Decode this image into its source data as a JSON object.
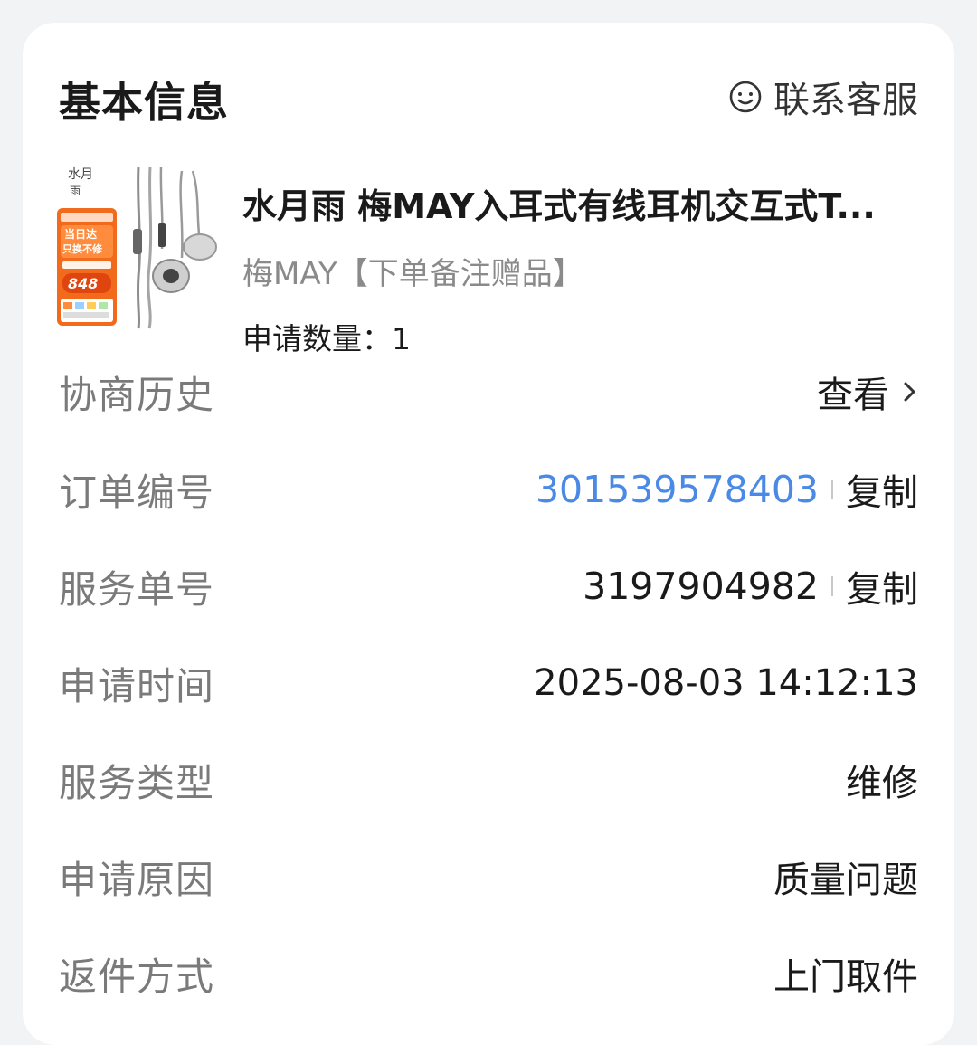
{
  "header": {
    "title": "基本信息",
    "service_label": "联系客服"
  },
  "product": {
    "title": "水月雨 梅MAY入耳式有线耳机交互式T...",
    "spec": "梅MAY【下单备注赠品】",
    "quantity": "申请数量：1",
    "thumb_text": {
      "badge_line1": "当日达",
      "badge_line2": "只换不修",
      "price": "848"
    }
  },
  "rows": [
    {
      "label": "协商历史",
      "value": "查看"
    },
    {
      "label": "订单编号",
      "value": "301539578403",
      "action": "复制"
    },
    {
      "label": "服务单号",
      "value": "3197904982",
      "action": "复制"
    },
    {
      "label": "申请时间",
      "value": "2025-08-03 14:12:13"
    },
    {
      "label": "服务类型",
      "value": "维修"
    },
    {
      "label": "申请原因",
      "value": "质量问题"
    },
    {
      "label": "返件方式",
      "value": "上门取件"
    }
  ],
  "colors": {
    "link_blue": "#4a8ae6",
    "label_gray": "#7a7a7a",
    "thumb_orange": "#f26a1b"
  },
  "icons": [
    "smile-chat-icon",
    "chevron-right-icon"
  ]
}
